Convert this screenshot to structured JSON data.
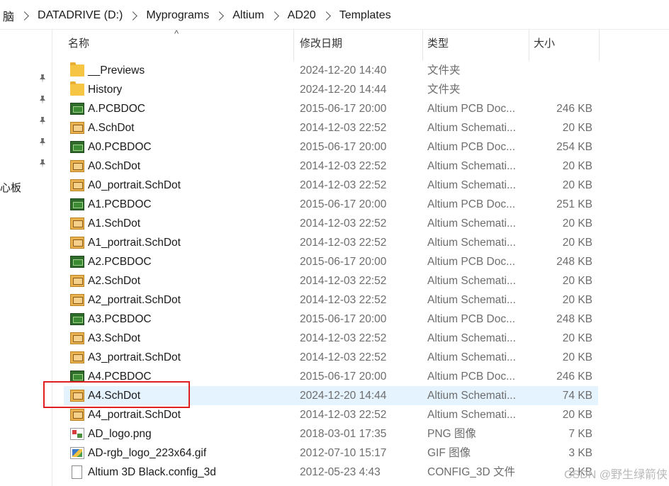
{
  "breadcrumb": [
    "脑",
    "DATADRIVE (D:)",
    "Myprograms",
    "Altium",
    "AD20",
    "Templates"
  ],
  "left_pane": {
    "label": "心板"
  },
  "columns": {
    "name": "名称",
    "date": "修改日期",
    "type": "类型",
    "size": "大小",
    "sort_indicator": "^"
  },
  "files": [
    {
      "name": "__Previews",
      "date": "2024-12-20 14:40",
      "type": "文件夹",
      "size": "",
      "icon": "folder-icon"
    },
    {
      "name": "History",
      "date": "2024-12-20 14:44",
      "type": "文件夹",
      "size": "",
      "icon": "folder-icon"
    },
    {
      "name": "A.PCBDOC",
      "date": "2015-06-17 20:00",
      "type": "Altium PCB Doc...",
      "size": "246 KB",
      "icon": "pcb-icon"
    },
    {
      "name": "A.SchDot",
      "date": "2014-12-03 22:52",
      "type": "Altium Schemati...",
      "size": "20 KB",
      "icon": "schematic-icon"
    },
    {
      "name": "A0.PCBDOC",
      "date": "2015-06-17 20:00",
      "type": "Altium PCB Doc...",
      "size": "254 KB",
      "icon": "pcb-icon"
    },
    {
      "name": "A0.SchDot",
      "date": "2014-12-03 22:52",
      "type": "Altium Schemati...",
      "size": "20 KB",
      "icon": "schematic-icon"
    },
    {
      "name": "A0_portrait.SchDot",
      "date": "2014-12-03 22:52",
      "type": "Altium Schemati...",
      "size": "20 KB",
      "icon": "schematic-icon"
    },
    {
      "name": "A1.PCBDOC",
      "date": "2015-06-17 20:00",
      "type": "Altium PCB Doc...",
      "size": "251 KB",
      "icon": "pcb-icon"
    },
    {
      "name": "A1.SchDot",
      "date": "2014-12-03 22:52",
      "type": "Altium Schemati...",
      "size": "20 KB",
      "icon": "schematic-icon"
    },
    {
      "name": "A1_portrait.SchDot",
      "date": "2014-12-03 22:52",
      "type": "Altium Schemati...",
      "size": "20 KB",
      "icon": "schematic-icon"
    },
    {
      "name": "A2.PCBDOC",
      "date": "2015-06-17 20:00",
      "type": "Altium PCB Doc...",
      "size": "248 KB",
      "icon": "pcb-icon"
    },
    {
      "name": "A2.SchDot",
      "date": "2014-12-03 22:52",
      "type": "Altium Schemati...",
      "size": "20 KB",
      "icon": "schematic-icon"
    },
    {
      "name": "A2_portrait.SchDot",
      "date": "2014-12-03 22:52",
      "type": "Altium Schemati...",
      "size": "20 KB",
      "icon": "schematic-icon"
    },
    {
      "name": "A3.PCBDOC",
      "date": "2015-06-17 20:00",
      "type": "Altium PCB Doc...",
      "size": "248 KB",
      "icon": "pcb-icon"
    },
    {
      "name": "A3.SchDot",
      "date": "2014-12-03 22:52",
      "type": "Altium Schemati...",
      "size": "20 KB",
      "icon": "schematic-icon"
    },
    {
      "name": "A3_portrait.SchDot",
      "date": "2014-12-03 22:52",
      "type": "Altium Schemati...",
      "size": "20 KB",
      "icon": "schematic-icon"
    },
    {
      "name": "A4.PCBDOC",
      "date": "2015-06-17 20:00",
      "type": "Altium PCB Doc...",
      "size": "246 KB",
      "icon": "pcb-icon"
    },
    {
      "name": "A4.SchDot",
      "date": "2024-12-20 14:44",
      "type": "Altium Schemati...",
      "size": "74 KB",
      "icon": "schematic-icon",
      "selected": true
    },
    {
      "name": "A4_portrait.SchDot",
      "date": "2014-12-03 22:52",
      "type": "Altium Schemati...",
      "size": "20 KB",
      "icon": "schematic-icon"
    },
    {
      "name": "AD_logo.png",
      "date": "2018-03-01 17:35",
      "type": "PNG 图像",
      "size": "7 KB",
      "icon": "png-image-icon"
    },
    {
      "name": "AD-rgb_logo_223x64.gif",
      "date": "2012-07-10 15:17",
      "type": "GIF 图像",
      "size": "3 KB",
      "icon": "gif-image-icon"
    },
    {
      "name": "Altium 3D Black.config_3d",
      "date": "2012-05-23 4:43",
      "type": "CONFIG_3D 文件",
      "size": "2 KB",
      "icon": "file-icon"
    }
  ],
  "watermark": "CSDN @野生绿箭侠",
  "colors": {
    "selected_row": "#e5f3ff",
    "highlight_box": "#e02020",
    "secondary_text": "#6d6d6d"
  }
}
